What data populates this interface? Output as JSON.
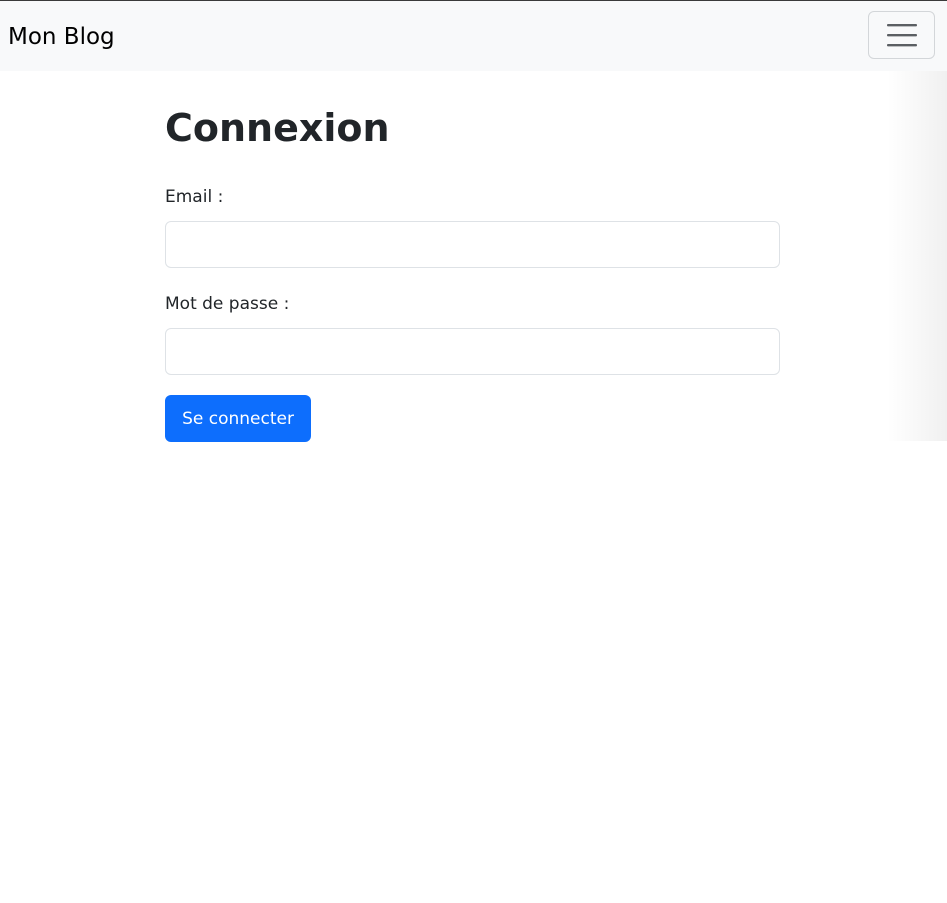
{
  "navbar": {
    "brand": "Mon Blog",
    "toggler_icon": "hamburger-menu-icon"
  },
  "login": {
    "title": "Connexion",
    "email_label": "Email :",
    "email_value": "",
    "password_label": "Mot de passe :",
    "password_value": "",
    "submit_label": "Se connecter"
  },
  "colors": {
    "navbar_bg": "#f8f9fa",
    "primary": "#0d6efd",
    "text": "#212529",
    "input_border": "#dee2e6"
  }
}
